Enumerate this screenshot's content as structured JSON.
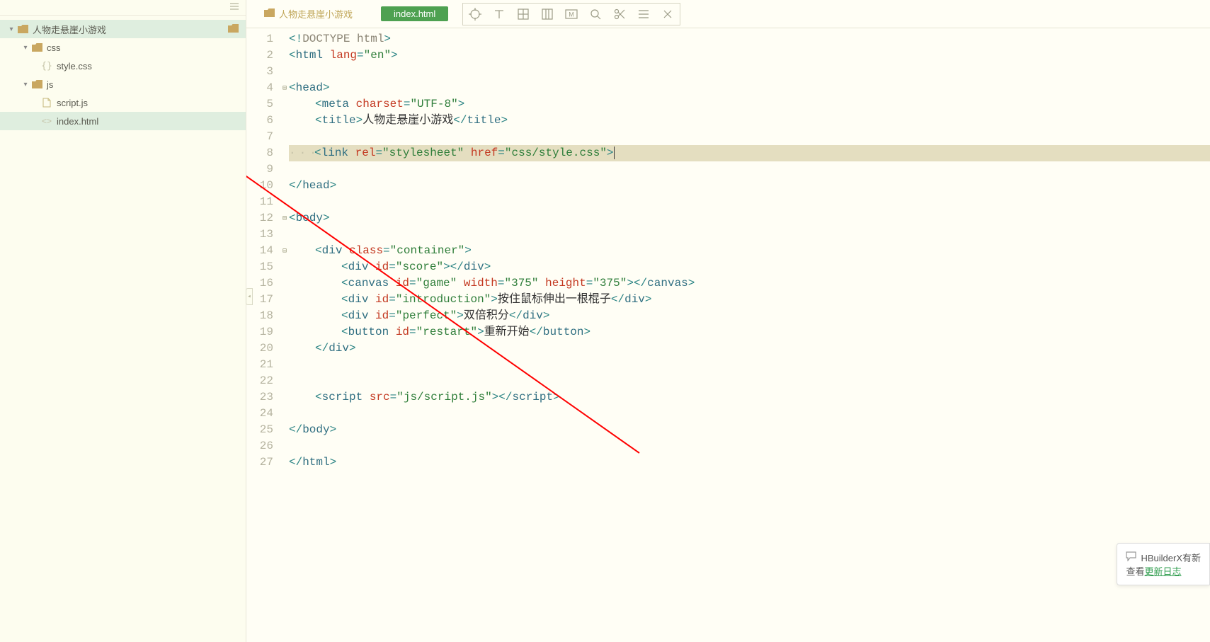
{
  "sidebar": {
    "root": {
      "label": "人物走悬崖小游戏"
    },
    "items": [
      {
        "label": "css",
        "type": "folder"
      },
      {
        "label": "style.css",
        "type": "css"
      },
      {
        "label": "js",
        "type": "folder"
      },
      {
        "label": "script.js",
        "type": "js"
      },
      {
        "label": "index.html",
        "type": "html"
      }
    ]
  },
  "breadcrumb": {
    "label": "人物走悬崖小游戏"
  },
  "tab": {
    "label": "index.html"
  },
  "code": {
    "lines": [
      {
        "n": 1,
        "segs": [
          {
            "c": "pun",
            "t": "<!"
          },
          {
            "c": "doctype",
            "t": "DOCTYPE html"
          },
          {
            "c": "pun",
            "t": ">"
          }
        ],
        "indent": 0
      },
      {
        "n": 2,
        "segs": [
          {
            "c": "pun",
            "t": "<"
          },
          {
            "c": "tagname",
            "t": "html"
          },
          {
            "c": "txt",
            "t": " "
          },
          {
            "c": "attr",
            "t": "lang"
          },
          {
            "c": "pun",
            "t": "="
          },
          {
            "c": "str",
            "t": "\"en\""
          },
          {
            "c": "pun",
            "t": ">"
          }
        ],
        "indent": 0
      },
      {
        "n": 3,
        "segs": [],
        "indent": 0
      },
      {
        "n": 4,
        "fold": "⊟",
        "segs": [
          {
            "c": "pun",
            "t": "<"
          },
          {
            "c": "tagname",
            "t": "head"
          },
          {
            "c": "pun",
            "t": ">"
          }
        ],
        "indent": 0
      },
      {
        "n": 5,
        "segs": [
          {
            "c": "pun",
            "t": "<"
          },
          {
            "c": "tagname",
            "t": "meta"
          },
          {
            "c": "txt",
            "t": " "
          },
          {
            "c": "attr",
            "t": "charset"
          },
          {
            "c": "pun",
            "t": "="
          },
          {
            "c": "str",
            "t": "\"UTF-8\""
          },
          {
            "c": "pun",
            "t": ">"
          }
        ],
        "indent": 1
      },
      {
        "n": 6,
        "segs": [
          {
            "c": "pun",
            "t": "<"
          },
          {
            "c": "tagname",
            "t": "title"
          },
          {
            "c": "pun",
            "t": ">"
          },
          {
            "c": "txt",
            "t": "人物走悬崖小游戏"
          },
          {
            "c": "pun",
            "t": "</"
          },
          {
            "c": "tagname",
            "t": "title"
          },
          {
            "c": "pun",
            "t": ">"
          }
        ],
        "indent": 1
      },
      {
        "n": 7,
        "segs": [],
        "indent": 0
      },
      {
        "n": 8,
        "hl": true,
        "dots": true,
        "cursor": true,
        "segs": [
          {
            "c": "pun",
            "t": "<"
          },
          {
            "c": "tagname",
            "t": "link"
          },
          {
            "c": "txt",
            "t": " "
          },
          {
            "c": "attr",
            "t": "rel"
          },
          {
            "c": "pun",
            "t": "="
          },
          {
            "c": "str",
            "t": "\"stylesheet\""
          },
          {
            "c": "txt",
            "t": " "
          },
          {
            "c": "attr",
            "t": "href"
          },
          {
            "c": "pun",
            "t": "="
          },
          {
            "c": "str",
            "t": "\"css/style.css\""
          },
          {
            "c": "pun",
            "t": ">"
          }
        ],
        "indent": 1
      },
      {
        "n": 9,
        "segs": [],
        "indent": 0
      },
      {
        "n": 10,
        "segs": [
          {
            "c": "pun",
            "t": "</"
          },
          {
            "c": "tagname",
            "t": "head"
          },
          {
            "c": "pun",
            "t": ">"
          }
        ],
        "indent": 0
      },
      {
        "n": 11,
        "segs": [],
        "indent": 0
      },
      {
        "n": 12,
        "fold": "⊟",
        "segs": [
          {
            "c": "pun",
            "t": "<"
          },
          {
            "c": "tagname",
            "t": "body"
          },
          {
            "c": "pun",
            "t": ">"
          }
        ],
        "indent": 0
      },
      {
        "n": 13,
        "segs": [],
        "indent": 0
      },
      {
        "n": 14,
        "fold": "⊟",
        "segs": [
          {
            "c": "pun",
            "t": "<"
          },
          {
            "c": "tagname",
            "t": "div"
          },
          {
            "c": "txt",
            "t": " "
          },
          {
            "c": "attr",
            "t": "class"
          },
          {
            "c": "pun",
            "t": "="
          },
          {
            "c": "str",
            "t": "\"container\""
          },
          {
            "c": "pun",
            "t": ">"
          }
        ],
        "indent": 1
      },
      {
        "n": 15,
        "segs": [
          {
            "c": "pun",
            "t": "<"
          },
          {
            "c": "tagname",
            "t": "div"
          },
          {
            "c": "txt",
            "t": " "
          },
          {
            "c": "attr",
            "t": "id"
          },
          {
            "c": "pun",
            "t": "="
          },
          {
            "c": "str",
            "t": "\"score\""
          },
          {
            "c": "pun",
            "t": "></"
          },
          {
            "c": "tagname",
            "t": "div"
          },
          {
            "c": "pun",
            "t": ">"
          }
        ],
        "indent": 2
      },
      {
        "n": 16,
        "segs": [
          {
            "c": "pun",
            "t": "<"
          },
          {
            "c": "tagname",
            "t": "canvas"
          },
          {
            "c": "txt",
            "t": " "
          },
          {
            "c": "attr",
            "t": "id"
          },
          {
            "c": "pun",
            "t": "="
          },
          {
            "c": "str",
            "t": "\"game\""
          },
          {
            "c": "txt",
            "t": " "
          },
          {
            "c": "attr",
            "t": "width"
          },
          {
            "c": "pun",
            "t": "="
          },
          {
            "c": "str",
            "t": "\"375\""
          },
          {
            "c": "txt",
            "t": " "
          },
          {
            "c": "attr",
            "t": "height"
          },
          {
            "c": "pun",
            "t": "="
          },
          {
            "c": "str",
            "t": "\"375\""
          },
          {
            "c": "pun",
            "t": "></"
          },
          {
            "c": "tagname",
            "t": "canvas"
          },
          {
            "c": "pun",
            "t": ">"
          }
        ],
        "indent": 2
      },
      {
        "n": 17,
        "segs": [
          {
            "c": "pun",
            "t": "<"
          },
          {
            "c": "tagname",
            "t": "div"
          },
          {
            "c": "txt",
            "t": " "
          },
          {
            "c": "attr",
            "t": "id"
          },
          {
            "c": "pun",
            "t": "="
          },
          {
            "c": "str",
            "t": "\"introduction\""
          },
          {
            "c": "pun",
            "t": ">"
          },
          {
            "c": "txt",
            "t": "按住鼠标伸出一根棍子"
          },
          {
            "c": "pun",
            "t": "</"
          },
          {
            "c": "tagname",
            "t": "div"
          },
          {
            "c": "pun",
            "t": ">"
          }
        ],
        "indent": 2
      },
      {
        "n": 18,
        "segs": [
          {
            "c": "pun",
            "t": "<"
          },
          {
            "c": "tagname",
            "t": "div"
          },
          {
            "c": "txt",
            "t": " "
          },
          {
            "c": "attr",
            "t": "id"
          },
          {
            "c": "pun",
            "t": "="
          },
          {
            "c": "str",
            "t": "\"perfect\""
          },
          {
            "c": "pun",
            "t": ">"
          },
          {
            "c": "txt",
            "t": "双倍积分"
          },
          {
            "c": "pun",
            "t": "</"
          },
          {
            "c": "tagname",
            "t": "div"
          },
          {
            "c": "pun",
            "t": ">"
          }
        ],
        "indent": 2
      },
      {
        "n": 19,
        "segs": [
          {
            "c": "pun",
            "t": "<"
          },
          {
            "c": "tagname",
            "t": "button"
          },
          {
            "c": "txt",
            "t": " "
          },
          {
            "c": "attr",
            "t": "id"
          },
          {
            "c": "pun",
            "t": "="
          },
          {
            "c": "str",
            "t": "\"restart\""
          },
          {
            "c": "pun",
            "t": ">"
          },
          {
            "c": "txt",
            "t": "重新开始"
          },
          {
            "c": "pun",
            "t": "</"
          },
          {
            "c": "tagname",
            "t": "button"
          },
          {
            "c": "pun",
            "t": ">"
          }
        ],
        "indent": 2
      },
      {
        "n": 20,
        "segs": [
          {
            "c": "pun",
            "t": "</"
          },
          {
            "c": "tagname",
            "t": "div"
          },
          {
            "c": "pun",
            "t": ">"
          }
        ],
        "indent": 1
      },
      {
        "n": 21,
        "segs": [],
        "indent": 0
      },
      {
        "n": 22,
        "segs": [],
        "indent": 0
      },
      {
        "n": 23,
        "segs": [
          {
            "c": "pun",
            "t": "<"
          },
          {
            "c": "tagname",
            "t": "script"
          },
          {
            "c": "txt",
            "t": " "
          },
          {
            "c": "attr",
            "t": "src"
          },
          {
            "c": "pun",
            "t": "="
          },
          {
            "c": "str",
            "t": "\"js/script.js\""
          },
          {
            "c": "pun",
            "t": "></"
          },
          {
            "c": "tagname",
            "t": "script"
          },
          {
            "c": "pun",
            "t": ">"
          }
        ],
        "indent": 1
      },
      {
        "n": 24,
        "segs": [],
        "indent": 0
      },
      {
        "n": 25,
        "segs": [
          {
            "c": "pun",
            "t": "</"
          },
          {
            "c": "tagname",
            "t": "body"
          },
          {
            "c": "pun",
            "t": ">"
          }
        ],
        "indent": 0
      },
      {
        "n": 26,
        "segs": [],
        "indent": 0
      },
      {
        "n": 27,
        "segs": [
          {
            "c": "pun",
            "t": "</"
          },
          {
            "c": "tagname",
            "t": "html"
          },
          {
            "c": "pun",
            "t": ">"
          }
        ],
        "indent": 0
      }
    ]
  },
  "notif": {
    "line1": "HBuilderX有新",
    "line2a": "查看",
    "line2b": "更新日志"
  }
}
